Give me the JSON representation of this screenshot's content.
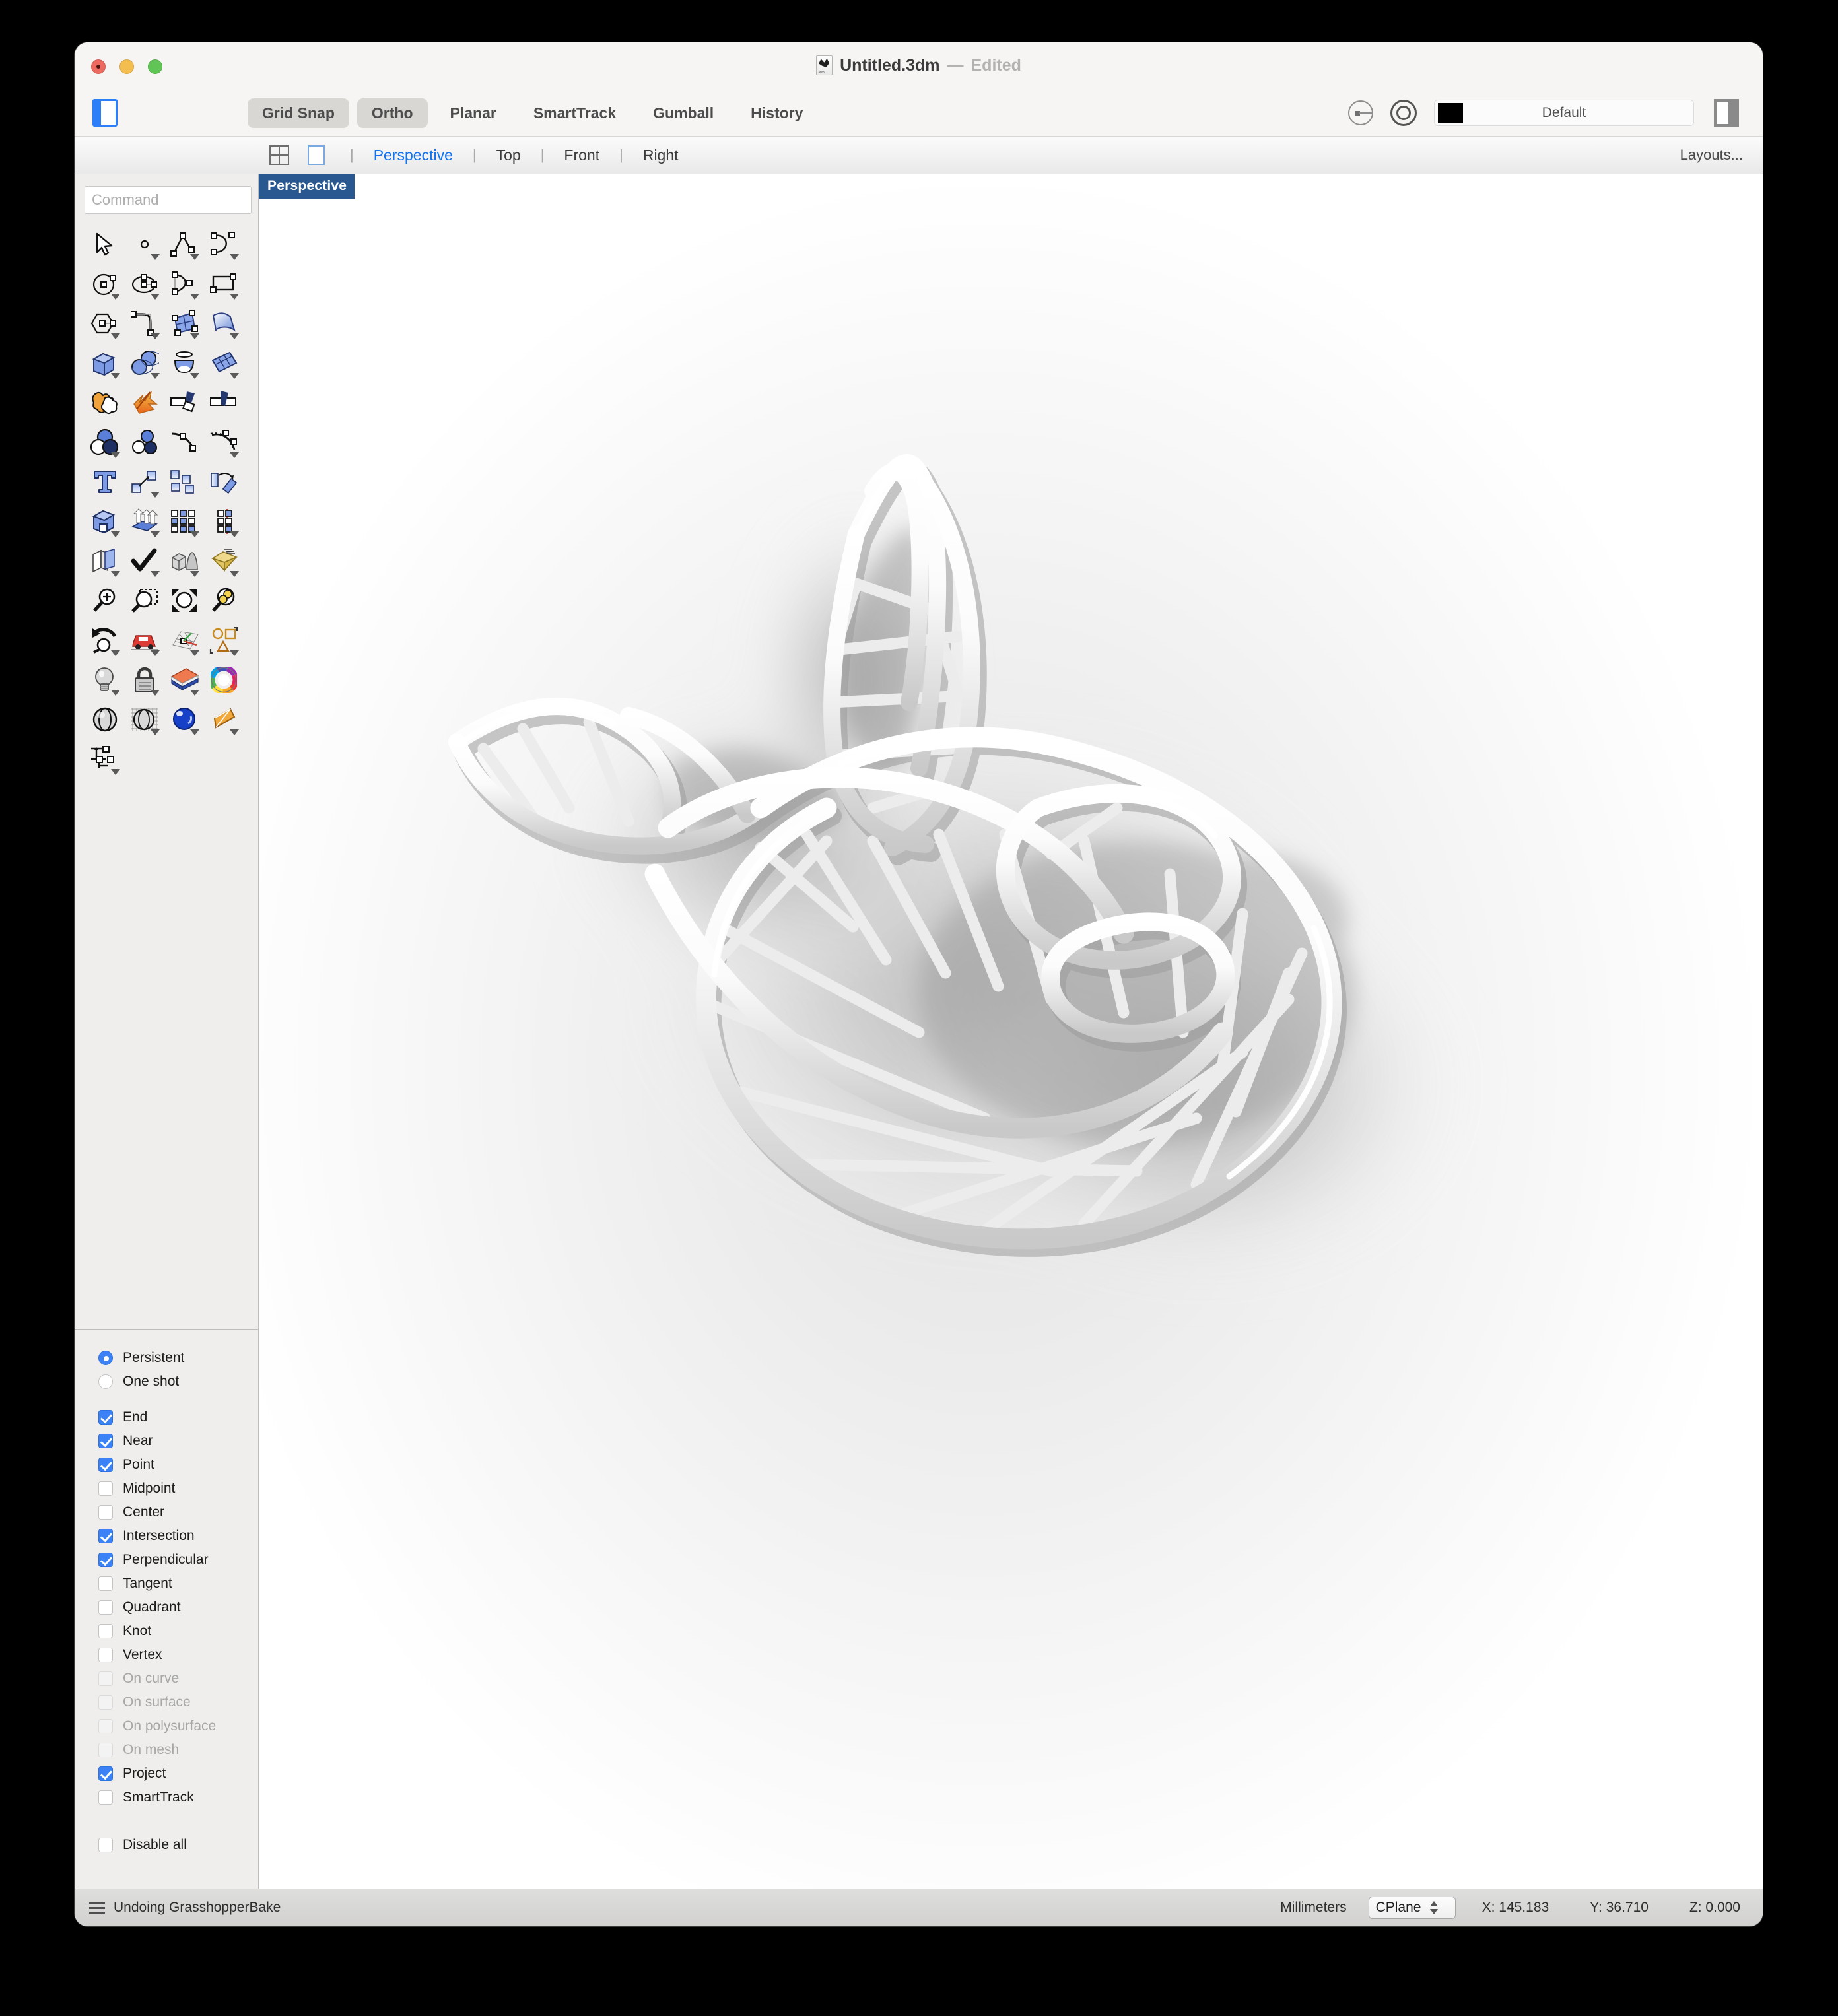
{
  "window": {
    "title": "Untitled.3dm",
    "title_separator": "—",
    "edited_label": "Edited",
    "doc_icon": "rhino-document-icon"
  },
  "toolbar": {
    "sidebar_toggle_icon": "left-sidebar-toggle-icon",
    "buttons": [
      {
        "label": "Grid Snap",
        "active": true
      },
      {
        "label": "Ortho",
        "active": true
      },
      {
        "label": "Planar",
        "active": false
      },
      {
        "label": "SmartTrack",
        "active": false
      },
      {
        "label": "Gumball",
        "active": false
      },
      {
        "label": "History",
        "active": false
      }
    ],
    "osnap_icon": "osnap-circle-arrow-icon",
    "record_icon": "record-circle-icon",
    "layer": {
      "name": "Default",
      "color": "#000000"
    },
    "right_panel_toggle_icon": "right-sidebar-toggle-icon"
  },
  "viewtabs": {
    "quad_icon": "four-viewport-icon",
    "single_icon": "single-viewport-icon",
    "separator": "|",
    "tabs": [
      {
        "label": "Perspective",
        "active": true
      },
      {
        "label": "Top",
        "active": false
      },
      {
        "label": "Front",
        "active": false
      },
      {
        "label": "Right",
        "active": false
      }
    ],
    "layouts_label": "Layouts..."
  },
  "command": {
    "value": "",
    "placeholder": "Command"
  },
  "palette": {
    "rows": [
      [
        {
          "name": "select-tool",
          "caret": false
        },
        {
          "name": "point-tool",
          "caret": true
        },
        {
          "name": "polyline-tool",
          "caret": true
        },
        {
          "name": "curve-tool",
          "caret": true
        }
      ],
      [
        {
          "name": "circle-tool",
          "caret": true
        },
        {
          "name": "ellipse-tool",
          "caret": true
        },
        {
          "name": "arc-tool",
          "caret": true
        },
        {
          "name": "rectangle-tool",
          "caret": true
        }
      ],
      [
        {
          "name": "polygon-tool",
          "caret": true
        },
        {
          "name": "fillet-tool",
          "caret": true
        },
        {
          "name": "surface-from-points-tool",
          "caret": true
        },
        {
          "name": "extrude-surface-tool",
          "caret": true
        }
      ],
      [
        {
          "name": "box-tool",
          "caret": true
        },
        {
          "name": "sphere-boolean-tool",
          "caret": true
        },
        {
          "name": "revolve-tool",
          "caret": true
        },
        {
          "name": "surface-patch-tool",
          "caret": true
        }
      ],
      [
        {
          "name": "boolean-union-tool",
          "caret": false
        },
        {
          "name": "explode-tool",
          "caret": false
        },
        {
          "name": "split-tool",
          "caret": false
        },
        {
          "name": "trim-tool",
          "caret": false
        }
      ],
      [
        {
          "name": "boolean-ops-tool",
          "caret": true
        },
        {
          "name": "separate-objects-tool",
          "caret": false
        },
        {
          "name": "curve-edit-points-tool",
          "caret": false
        },
        {
          "name": "rebuild-curve-tool",
          "caret": true
        }
      ],
      [
        {
          "name": "text-tool",
          "caret": false
        },
        {
          "name": "move-tool",
          "caret": true
        },
        {
          "name": "copy-tool",
          "caret": false
        },
        {
          "name": "rotate-tool",
          "caret": false
        }
      ],
      [
        {
          "name": "solid-edit-tool",
          "caret": true
        },
        {
          "name": "extrude-array-tool",
          "caret": true
        },
        {
          "name": "array-tool",
          "caret": true
        },
        {
          "name": "mirror-tool",
          "caret": true
        }
      ],
      [
        {
          "name": "layer-tools",
          "caret": true
        },
        {
          "name": "check-objects-tool",
          "caret": true
        },
        {
          "name": "mesh-tools",
          "caret": true
        },
        {
          "name": "render-mesh-tool",
          "caret": true
        }
      ],
      [
        {
          "name": "zoom-tool",
          "caret": false
        },
        {
          "name": "zoom-window-tool",
          "caret": false
        },
        {
          "name": "zoom-extents-tool",
          "caret": false
        },
        {
          "name": "zoom-selected-tool",
          "caret": false
        }
      ],
      [
        {
          "name": "zoom-previous-tool",
          "caret": true
        },
        {
          "name": "named-views-tool",
          "caret": true
        },
        {
          "name": "cplane-tool",
          "caret": true
        },
        {
          "name": "named-selection-tool",
          "caret": true
        }
      ],
      [
        {
          "name": "light-tool",
          "caret": true
        },
        {
          "name": "lock-tool",
          "caret": true
        },
        {
          "name": "material-tool",
          "caret": true
        },
        {
          "name": "color-wheel-tool",
          "caret": false
        }
      ],
      [
        {
          "name": "shaded-view-tool",
          "caret": false
        },
        {
          "name": "ghosted-view-tool",
          "caret": true
        },
        {
          "name": "rendered-view-tool",
          "caret": true
        },
        {
          "name": "spotlight-tool",
          "caret": true
        }
      ],
      [
        {
          "name": "dimension-tool",
          "caret": true
        }
      ]
    ]
  },
  "osnap": {
    "modes": [
      {
        "label": "Persistent",
        "selected": true
      },
      {
        "label": "One shot",
        "selected": false
      }
    ],
    "items": [
      {
        "label": "End",
        "checked": true,
        "disabled": false
      },
      {
        "label": "Near",
        "checked": true,
        "disabled": false
      },
      {
        "label": "Point",
        "checked": true,
        "disabled": false
      },
      {
        "label": "Midpoint",
        "checked": false,
        "disabled": false
      },
      {
        "label": "Center",
        "checked": false,
        "disabled": false
      },
      {
        "label": "Intersection",
        "checked": true,
        "disabled": false
      },
      {
        "label": "Perpendicular",
        "checked": true,
        "disabled": false
      },
      {
        "label": "Tangent",
        "checked": false,
        "disabled": false
      },
      {
        "label": "Quadrant",
        "checked": false,
        "disabled": false
      },
      {
        "label": "Knot",
        "checked": false,
        "disabled": false
      },
      {
        "label": "Vertex",
        "checked": false,
        "disabled": false
      },
      {
        "label": "On curve",
        "checked": false,
        "disabled": true
      },
      {
        "label": "On surface",
        "checked": false,
        "disabled": true
      },
      {
        "label": "On polysurface",
        "checked": false,
        "disabled": true
      },
      {
        "label": "On mesh",
        "checked": false,
        "disabled": true
      },
      {
        "label": "Project",
        "checked": true,
        "disabled": false
      },
      {
        "label": "SmartTrack",
        "checked": false,
        "disabled": false
      }
    ],
    "disable_all": {
      "label": "Disable all",
      "checked": false
    }
  },
  "viewport": {
    "label": "Perspective",
    "model_description": "white-tube-wireframe-sculpture"
  },
  "statusbar": {
    "menu_icon": "hamburger-icon",
    "message": "Undoing GrasshopperBake",
    "units": "Millimeters",
    "cplane": "CPlane",
    "x": "X: 145.183",
    "y": "Y: 36.710",
    "z": "Z: 0.000"
  },
  "colors": {
    "accent_blue": "#1273ee",
    "viewport_label_bg": "#28588f",
    "checkbox_blue": "#3b82f6",
    "window_bg": "#f6f5f3"
  }
}
